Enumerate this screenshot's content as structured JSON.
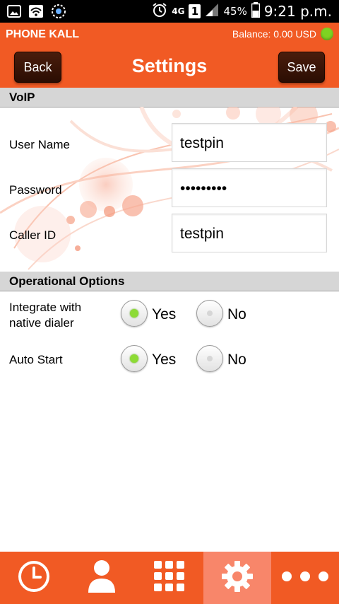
{
  "status_bar": {
    "network": "4G",
    "sim": "1",
    "battery": "45%",
    "time": "9:21 p.m."
  },
  "app": {
    "name": "PHONE KALL",
    "balance": "Balance: 0.00 USD",
    "status_color": "#7ed321",
    "accent_color": "#f15a24"
  },
  "header": {
    "back_label": "Back",
    "title": "Settings",
    "save_label": "Save"
  },
  "voip": {
    "section_title": "VoIP",
    "fields": [
      {
        "label": "User Name",
        "value": "testpin"
      },
      {
        "label": "Password",
        "value": "•••••••••"
      },
      {
        "label": "Caller ID",
        "value": "testpin"
      }
    ]
  },
  "operational": {
    "section_title": "Operational Options",
    "options": [
      {
        "label_line1": "Integrate with",
        "label_line2": "native dialer",
        "yes": "Yes",
        "no": "No",
        "selected": "Yes"
      },
      {
        "label_line1": "Auto Start",
        "label_line2": "",
        "yes": "Yes",
        "no": "No",
        "selected": "Yes"
      }
    ]
  },
  "bottom_nav": {
    "items": [
      "clock-icon",
      "contacts-icon",
      "dialpad-icon",
      "gear-icon",
      "more-icon"
    ],
    "active": "gear-icon"
  }
}
